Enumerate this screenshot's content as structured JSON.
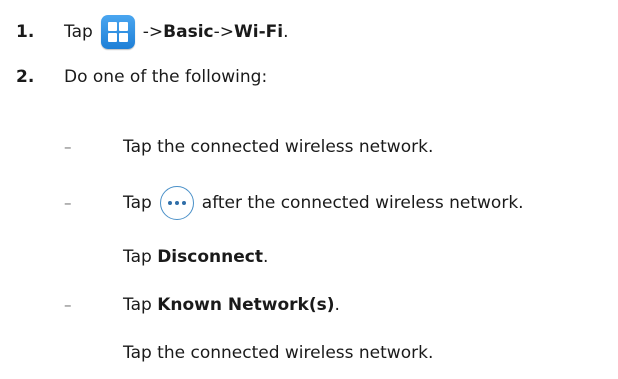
{
  "steps": [
    {
      "number": "1.",
      "prefix": "Tap",
      "icon": "apps-grid-icon",
      "arrow1": "->",
      "basic": "Basic",
      "arrow2": "->",
      "wifi": "Wi-Fi",
      "end": "."
    },
    {
      "number": "2.",
      "text": "Do one of the following:"
    }
  ],
  "options": {
    "dash": "–",
    "opt1": "Tap the connected wireless network.",
    "opt2_prefix": "Tap",
    "opt2_icon": "more-options-icon",
    "opt2_suffix": "after the connected wireless network.",
    "opt2_line2_prefix": "Tap",
    "opt2_line2_bold": "Disconnect",
    "opt2_line2_end": ".",
    "opt3_prefix": "Tap",
    "opt3_bold": "Known Network(s)",
    "opt3_end": ".",
    "opt3_line2": "Tap the connected wireless network."
  },
  "colors": {
    "icon_blue": "#1e7fd6",
    "icon_border": "#4a90c8"
  }
}
